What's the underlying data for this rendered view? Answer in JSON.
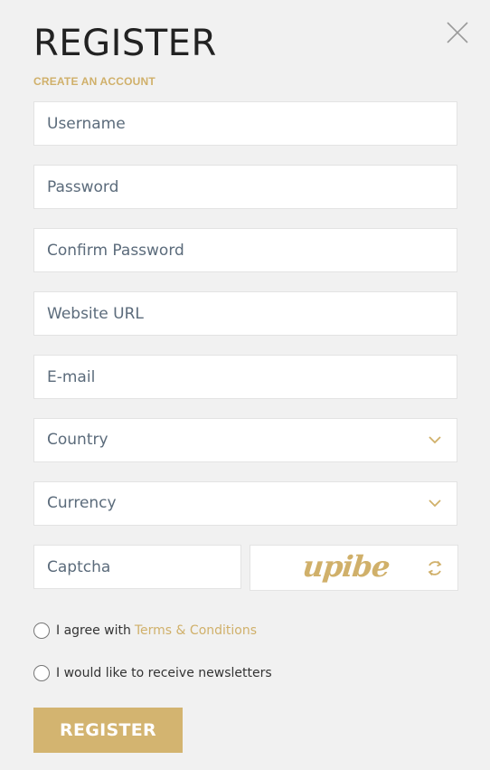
{
  "header": {
    "title": "REGISTER",
    "subtitle": "CREATE AN ACCOUNT",
    "close_icon": "close-icon"
  },
  "form": {
    "username_placeholder": "Username",
    "password_placeholder": "Password",
    "confirm_password_placeholder": "Confirm Password",
    "website_placeholder": "Website URL",
    "email_placeholder": "E-mail",
    "country_select": "Country",
    "currency_select": "Currency",
    "captcha_placeholder": "Captcha",
    "captcha_code": "upibe",
    "terms_prefix": "I agree with",
    "terms_link": "Terms & Conditions",
    "newsletter_label": "I would like to receive newsletters",
    "submit_label": "REGISTER"
  },
  "colors": {
    "accent": "#d3b470",
    "background": "#f1f1f1",
    "field_background": "#ffffff",
    "title": "#222222"
  }
}
